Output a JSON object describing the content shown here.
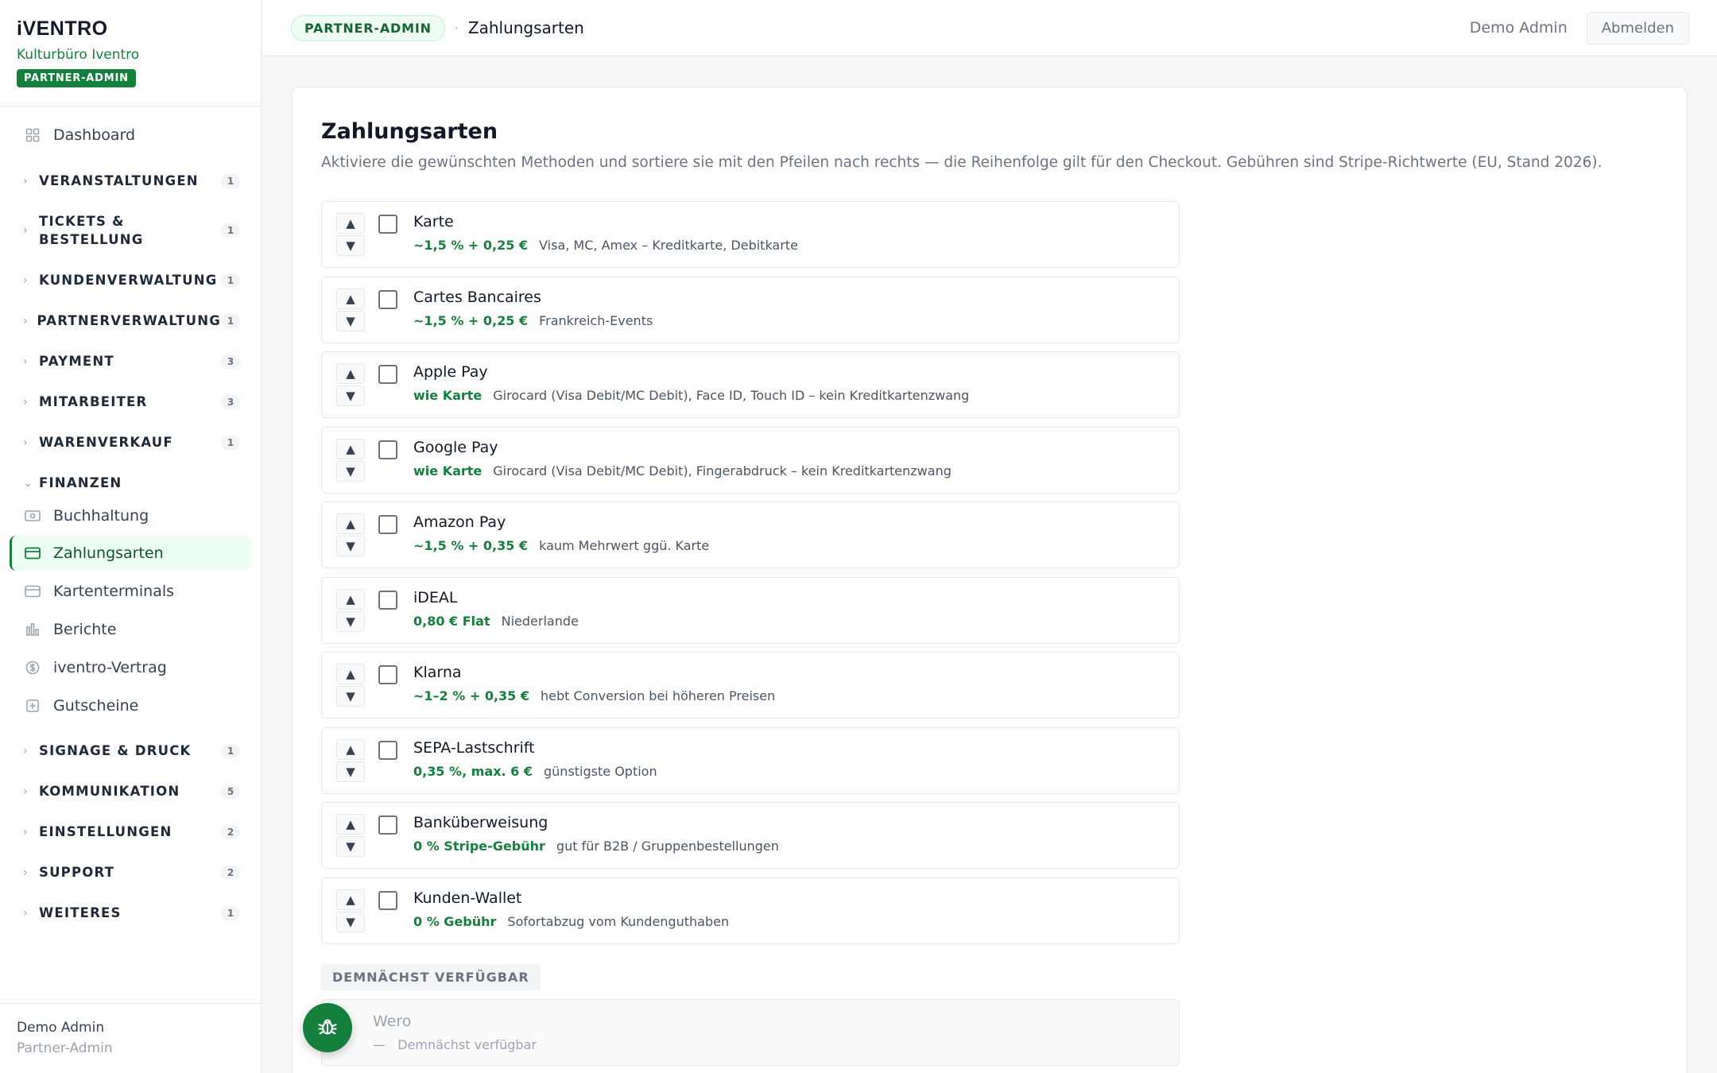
{
  "brand": {
    "logo": "iVENTRO",
    "org": "Kulturbüro Iventro",
    "badge": "PARTNER-ADMIN"
  },
  "sidebar": {
    "dashboard": "Dashboard",
    "groups": [
      {
        "label": "VERANSTALTUNGEN",
        "count": "1"
      },
      {
        "label": "TICKETS & BESTELLUNG",
        "count": "1"
      },
      {
        "label": "KUNDENVERWALTUNG",
        "count": "1"
      },
      {
        "label": "PARTNERVERWALTUNG",
        "count": "1"
      },
      {
        "label": "PAYMENT",
        "count": "3"
      },
      {
        "label": "MITARBEITER",
        "count": "3"
      },
      {
        "label": "WARENVERKAUF",
        "count": "1"
      },
      {
        "label": "FINANZEN",
        "count": ""
      },
      {
        "label": "SIGNAGE & DRUCK",
        "count": "1"
      },
      {
        "label": "KOMMUNIKATION",
        "count": "5"
      },
      {
        "label": "EINSTELLUNGEN",
        "count": "2"
      },
      {
        "label": "SUPPORT",
        "count": "2"
      },
      {
        "label": "WEITERES",
        "count": "1"
      }
    ],
    "finance_items": [
      "Buchhaltung",
      "Zahlungsarten",
      "Kartenterminals",
      "Berichte",
      "iventro-Vertrag",
      "Gutscheine"
    ],
    "footer": {
      "name": "Demo Admin",
      "role": "Partner-Admin"
    }
  },
  "header": {
    "badge": "PARTNER-ADMIN",
    "separator": "·",
    "title": "Zahlungsarten",
    "user": "Demo Admin",
    "logout": "Abmelden"
  },
  "page": {
    "title": "Zahlungsarten",
    "description": "Aktiviere die gewünschten Methoden und sortiere sie mit den Pfeilen nach rechts — die Reihenfolge gilt für den Checkout. Gebühren sind Stripe-Richtwerte (EU, Stand 2026).",
    "arrow_up": "▲",
    "arrow_down": "▼"
  },
  "methods": [
    {
      "name": "Karte",
      "fee": "~1,5 % + 0,25 €",
      "desc": "Visa, MC, Amex – Kreditkarte, Debitkarte"
    },
    {
      "name": "Cartes Bancaires",
      "fee": "~1,5 % + 0,25 €",
      "desc": "Frankreich-Events"
    },
    {
      "name": "Apple Pay",
      "fee": "wie Karte",
      "desc": "Girocard (Visa Debit/MC Debit), Face ID, Touch ID – kein Kreditkartenzwang"
    },
    {
      "name": "Google Pay",
      "fee": "wie Karte",
      "desc": "Girocard (Visa Debit/MC Debit), Fingerabdruck – kein Kreditkartenzwang"
    },
    {
      "name": "Amazon Pay",
      "fee": "~1,5 % + 0,35 €",
      "desc": "kaum Mehrwert ggü. Karte"
    },
    {
      "name": "iDEAL",
      "fee": "0,80 € Flat",
      "desc": "Niederlande"
    },
    {
      "name": "Klarna",
      "fee": "~1–2 % + 0,35 €",
      "desc": "hebt Conversion bei höheren Preisen"
    },
    {
      "name": "SEPA-Lastschrift",
      "fee": "0,35 %, max. 6 €",
      "desc": "günstigste Option"
    },
    {
      "name": "Banküberweisung",
      "fee": "0 % Stripe-Gebühr",
      "desc": "gut für B2B / Gruppenbestellungen"
    },
    {
      "name": "Kunden-Wallet",
      "fee": "0 % Gebühr",
      "desc": "Sofortabzug vom Kundenguthaben"
    }
  ],
  "soon": {
    "label": "DEMNÄCHST VERFÜGBAR",
    "name": "Wero",
    "dash": "—",
    "meta": "Demnächst verfügbar"
  },
  "colors": {
    "accent": "#15803d",
    "accent_bg": "#ecfdf3"
  },
  "icons": {
    "fab": "bug-icon"
  }
}
